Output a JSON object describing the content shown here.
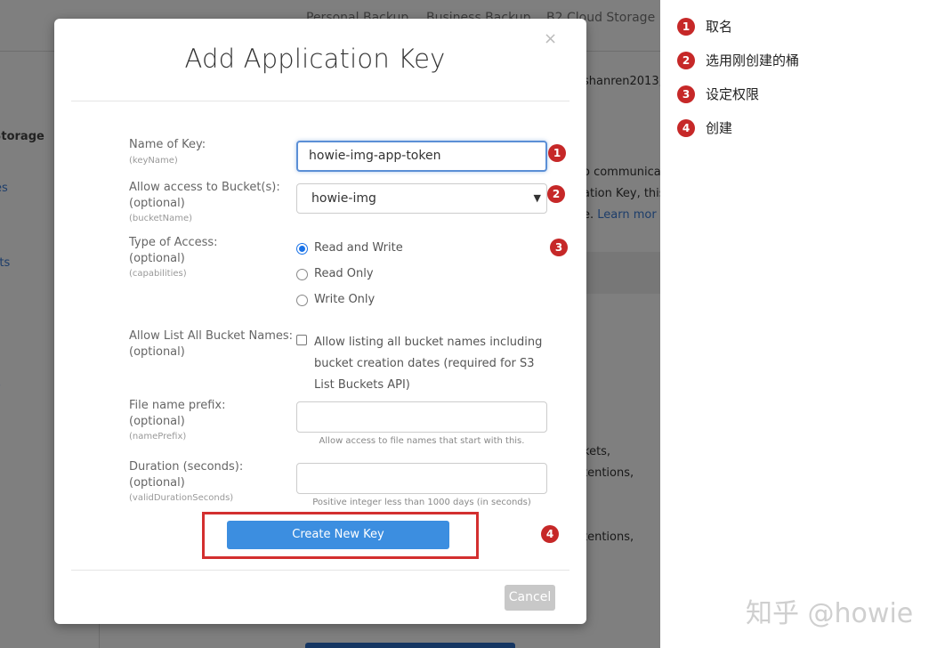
{
  "background": {
    "nav": [
      "Personal Backup",
      "Business Backup",
      "B2 Cloud Storage"
    ],
    "sidebar": {
      "heading": "Storage",
      "items": [
        "es",
        "rts",
        "s"
      ]
    },
    "account_fragment": "shanren2013,",
    "body_fragments": [
      "o communicat",
      "ation Key, this k",
      "e. "
    ],
    "learn_more": "Learn mor",
    "list_fragments": [
      "kets,",
      "tentions,",
      "tentions,"
    ]
  },
  "modal": {
    "title": "Add Application Key",
    "close": "×",
    "fields": {
      "key_name": {
        "label": "Name of Key:",
        "hint": "(keyName)",
        "value": "howie-img-app-token"
      },
      "bucket": {
        "label": "Allow access to Bucket(s):",
        "optional": "(optional)",
        "hint": "(bucketName)",
        "value": "howie-img"
      },
      "access": {
        "label": "Type of Access:",
        "optional": "(optional)",
        "hint": "(capabilities)",
        "options": [
          "Read and Write",
          "Read Only",
          "Write Only"
        ],
        "selected": "Read and Write"
      },
      "list_all": {
        "label": "Allow List All Bucket Names:",
        "optional": "(optional)",
        "text": "Allow listing all bucket names including bucket creation dates (required for S3 List Buckets API)",
        "checked": false
      },
      "prefix": {
        "label": "File name prefix:",
        "optional": "(optional)",
        "hint": "(namePrefix)",
        "value": "",
        "help": "Allow access to file names that start with this."
      },
      "duration": {
        "label": "Duration (seconds):",
        "optional": "(optional)",
        "hint": "(validDurationSeconds)",
        "value": "",
        "help": "Positive integer less than 1000 days (in seconds)"
      }
    },
    "create_button": "Create New Key",
    "cancel_button": "Cancel"
  },
  "annotations": {
    "markers": [
      "1",
      "2",
      "3",
      "4"
    ],
    "legend": [
      {
        "num": "1",
        "text": "取名"
      },
      {
        "num": "2",
        "text": "选用刚创建的桶"
      },
      {
        "num": "3",
        "text": "设定权限"
      },
      {
        "num": "4",
        "text": "创建"
      }
    ],
    "marker_color": "#c62828"
  },
  "watermark": "知乎 @howie",
  "colors": {
    "primary_button": "#3c8ee0",
    "focus_border": "#5b8fd6",
    "radio_selected": "#1a73e8",
    "highlight_box": "#d32f2f"
  }
}
